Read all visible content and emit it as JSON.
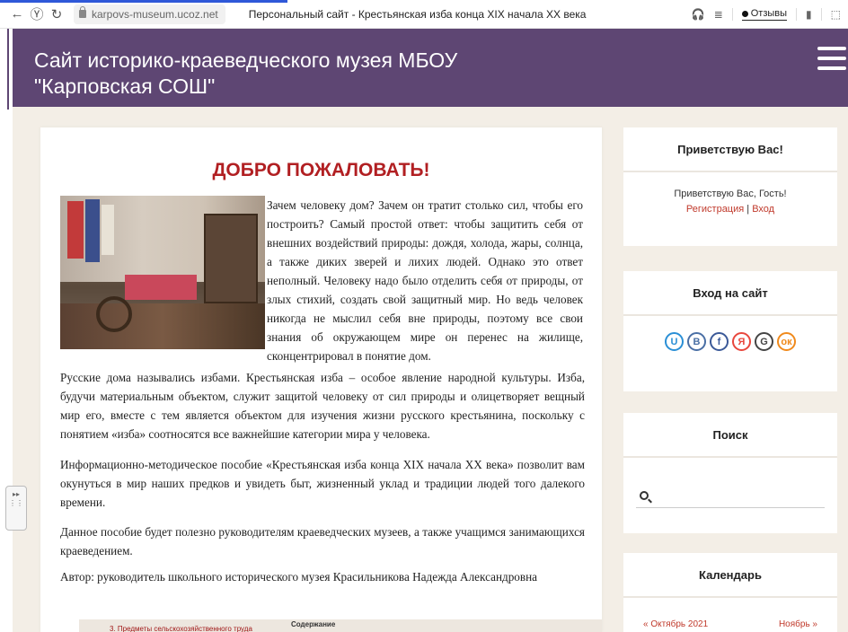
{
  "browser": {
    "url": "karpovs-museum.ucoz.net",
    "tab_title": "Персональный сайт - Крестьянская изба конца XIX начала XX века",
    "reviews_label": "Отзывы"
  },
  "header": {
    "site_title": "Сайт историко-краеведческого музея МБОУ \"Карповская СОШ\""
  },
  "main": {
    "welcome": "ДОБРО ПОЖАЛОВАТЬ!",
    "intro": "Зачем человеку дом? Зачем он тратит столько сил, чтобы его построить? Самый простой ответ: чтобы защитить себя от внешних воздействий природы: дождя, холода, жары, солнца, а также диких зверей и лихих людей. Однако это ответ неполный. Человеку надо было отделить себя от природы, от злых стихий, создать свой защитный мир. Но ведь человек никогда не мыслил себя вне природы, поэтому все свои знания об окружающем мире он перенес на жилище, сконцентрировал в понятие дом.",
    "p2": "Русские дома назывались избами. Крестьянская изба – особое явление народной культуры. Изба, будучи материальным объектом, служит защитой человеку от сил природы и олицетворяет вещный мир его, вместе с тем является объектом для изучения жизни русского крестьянина, поскольку с понятием «изба» соотносятся все важнейшие категории мира у человека.",
    "p3": "Информационно-методическое пособие «Крестьянская изба конца XIX начала XX века» позволит вам окунуться в мир наших предков и увидеть быт, жизненный уклад и традиции людей того далекого времени.",
    "p4": "Данное пособие будет полезно руководителям краеведческих музеев, а также учащимся занимающихся краеведением.",
    "p5": "Автор: руководитель школьного исторического музея Красильникова Надежда Александровна"
  },
  "sidebar": {
    "greeting": {
      "title": "Приветствую Вас!",
      "text": "Приветствую Вас, Гость!",
      "register": "Регистрация",
      "divider": "|",
      "login": "Вход"
    },
    "login_block": {
      "title": "Вход на сайт",
      "socials": [
        {
          "glyph": "U",
          "color": "#2a8fd6"
        },
        {
          "glyph": "В",
          "color": "#4a6fa5"
        },
        {
          "glyph": "f",
          "color": "#3b5998"
        },
        {
          "glyph": "Я",
          "color": "#e8473d"
        },
        {
          "glyph": "G",
          "color": "#444444"
        },
        {
          "glyph": "ок",
          "color": "#f08a1c"
        }
      ]
    },
    "search": {
      "title": "Поиск",
      "placeholder": ""
    },
    "calendar": {
      "title": "Календарь",
      "month": "« Октябрь 2021",
      "next": "Ноябрь »"
    }
  },
  "bottom": {
    "contents": "Содержание",
    "item": "3. Предметы сельскохозяйственного труда"
  }
}
